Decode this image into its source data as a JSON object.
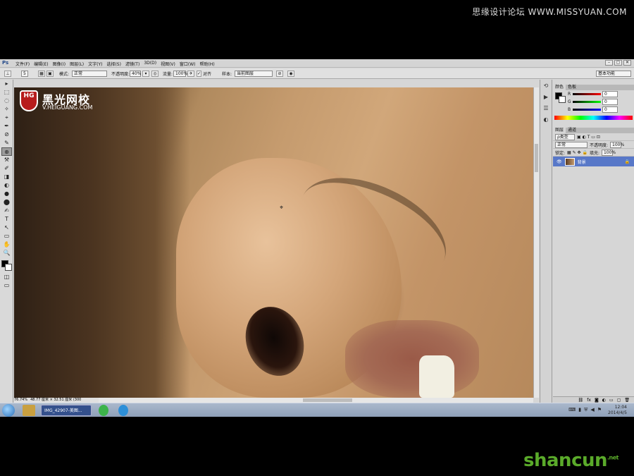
{
  "watermark_top": "思缘设计论坛 WWW.MISSYUAN.COM",
  "app": {
    "logo": "Ps",
    "menu": [
      "文件(F)",
      "编辑(E)",
      "图像(I)",
      "图层(L)",
      "文字(Y)",
      "选择(S)",
      "滤镜(T)",
      "3D(D)",
      "视图(V)",
      "窗口(W)",
      "帮助(H)"
    ],
    "window_controls": [
      "–",
      "▢",
      "✕"
    ]
  },
  "options": {
    "brush_size": "5",
    "mode_label": "模式:",
    "mode_value": "正常",
    "opacity_label": "不透明度:",
    "opacity_value": "40%",
    "flow_label": "流量:",
    "flow_value": "100%",
    "align_label": "对齐",
    "sample_label": "样本:",
    "sample_value": "当前图层",
    "workspace": "基本功能"
  },
  "tools": [
    "▸",
    "⬚",
    "◌",
    "✧",
    "⌖",
    "✒",
    "⊘",
    "✎",
    "⊕",
    "⚒",
    "✐",
    "◨",
    "◐",
    "●",
    "⬤",
    "✍",
    "T",
    "↖",
    "▭",
    "✋",
    "🔍"
  ],
  "canvas": {
    "brand_name": "黑光网校",
    "brand_url": "V.HEIGUANG.COM",
    "shield_text": "HG"
  },
  "status": {
    "zoom": "76.74%",
    "doc_size": "48.77 厘米 × 32.51 厘米 (300"
  },
  "color_panel": {
    "tabs": [
      "颜色",
      "色板"
    ],
    "channels": [
      {
        "label": "R",
        "value": "0",
        "color": "#e02020"
      },
      {
        "label": "G",
        "value": "0",
        "color": "#20a020"
      },
      {
        "label": "B",
        "value": "0",
        "color": "#2040e0"
      }
    ]
  },
  "layers_panel": {
    "tabs": [
      "图层",
      "通道"
    ],
    "kind_label": "ρ类型",
    "blend_mode": "正常",
    "opacity_label": "不透明度:",
    "opacity_value": "100%",
    "lock_label": "锁定:",
    "fill_label": "填充:",
    "fill_value": "100%",
    "layer_name": "背景"
  },
  "taskbar": {
    "active_window": "IMG_42907-美图...",
    "time": "12:04",
    "date": "2014/4/5"
  },
  "watermark_bottom": {
    "text": "shancun",
    "suffix": ".net"
  }
}
